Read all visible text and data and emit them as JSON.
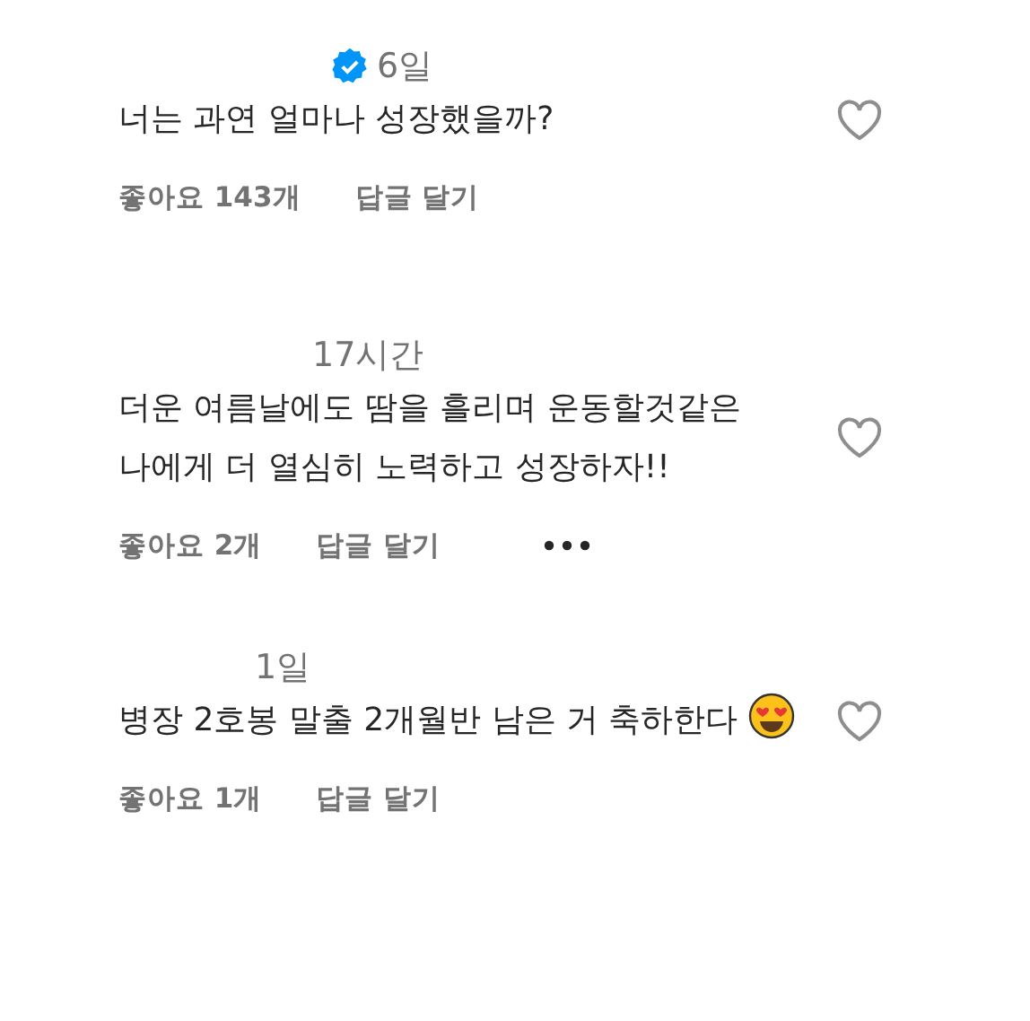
{
  "comments": [
    {
      "verified": true,
      "time": "6일",
      "text": "너는 과연 얼마나 성장했을까?",
      "emoji": false,
      "liked": false,
      "likes": "좋아요 143개",
      "reply": "답글 달기",
      "more_menu": false
    },
    {
      "verified": false,
      "time": "17시간",
      "text": "더운 여름날에도 땀을 흘리며 운동할것같은 나에게 더 열심히 노력하고 성장하자!!",
      "emoji": false,
      "liked": false,
      "likes": "좋아요 2개",
      "reply": "답글 달기",
      "more_menu": true
    },
    {
      "verified": false,
      "time": "1일",
      "text": "병장 2호봉 말출 2개월반 남은 거 축하한다",
      "emoji": true,
      "liked": false,
      "likes": "좋아요 1개",
      "reply": "답글 달기",
      "more_menu": false
    }
  ]
}
